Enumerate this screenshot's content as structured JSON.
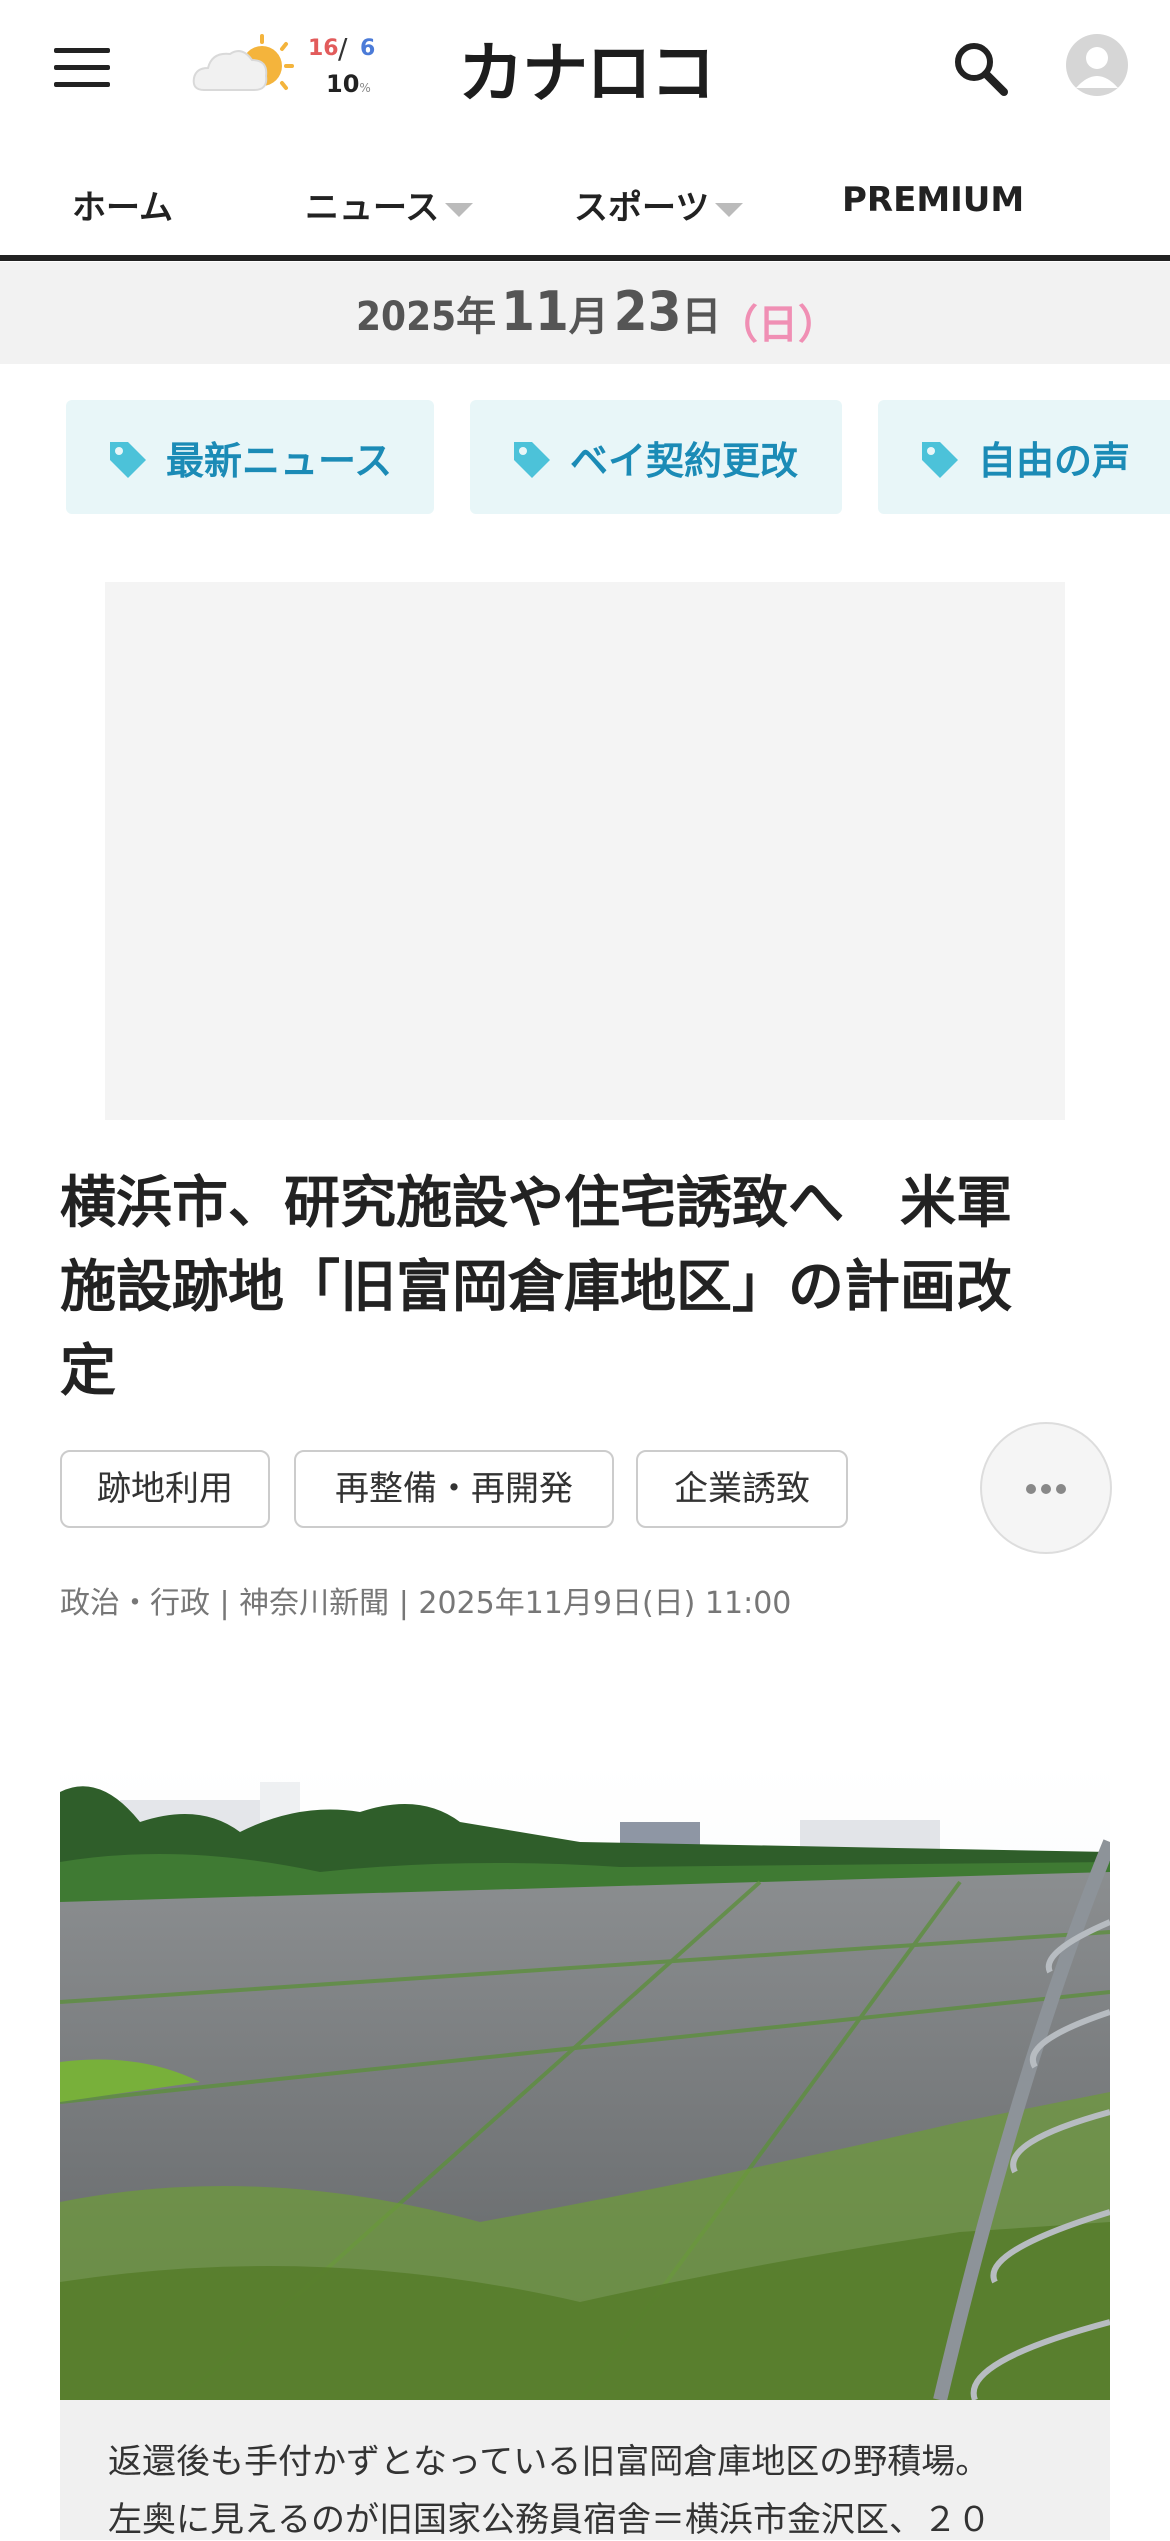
{
  "header": {
    "logo": "カナロコ",
    "weather": {
      "temp_high": "16",
      "temp_slash": "/",
      "temp_low": "6",
      "rain_chance": "10",
      "rain_unit": "%",
      "icon": "partly-cloudy-sun-icon"
    },
    "icons": {
      "menu": "hamburger-menu-icon",
      "search": "search-icon",
      "account": "user-avatar-icon"
    }
  },
  "nav": {
    "items": [
      {
        "label": "ホーム",
        "has_dropdown": false
      },
      {
        "label": "ニュース",
        "has_dropdown": true
      },
      {
        "label": "スポーツ",
        "has_dropdown": true
      },
      {
        "label": "PREMIUM",
        "has_dropdown": false
      }
    ]
  },
  "date_bar": {
    "year": "2025",
    "year_unit": "年",
    "month": "11",
    "month_unit": "月",
    "day": "23",
    "day_unit": "日",
    "weekday": "（日）"
  },
  "topic_tags": [
    {
      "label": "最新ニュース",
      "icon": "tag-icon"
    },
    {
      "label": "ベイ契約更改",
      "icon": "tag-icon"
    },
    {
      "label": "自由の声",
      "icon": "tag-icon"
    }
  ],
  "article": {
    "title_line1": "横浜市、研究施設や住宅誘致へ　米軍",
    "title_line2": "施設跡地「旧富岡倉庫地区」の計画改",
    "title_line3": "定",
    "keywords": [
      "跡地利用",
      "再整備・再開発",
      "企業誘致"
    ],
    "meta": "政治・行政 | 神奈川新聞 | 2025年11月9日(日) 11:00",
    "caption_line1": "返還後も手付かずとなっている旧富岡倉庫地区の野積場。",
    "caption_line2": "左奥に見えるのが旧国家公務員宿舎＝横浜市金沢区、２０"
  },
  "colors": {
    "accent_blue": "#1b8bb6",
    "tag_bg": "#e8f6f8",
    "weekday_pink": "#f08fb4",
    "temp_high": "#e25b5b",
    "temp_low": "#4b7bd8"
  }
}
